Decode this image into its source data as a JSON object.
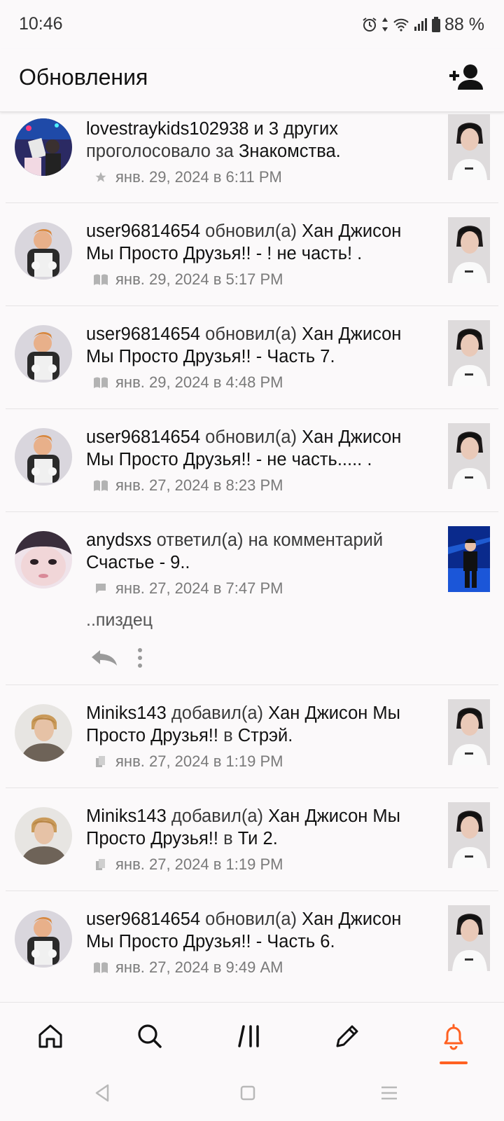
{
  "status": {
    "time": "10:46",
    "battery": "88 %"
  },
  "header": {
    "title": "Обновления"
  },
  "feed": [
    {
      "actor": "lovestraykids102938 и 3 других",
      "verb": "проголосовало за",
      "target": "Знакомства",
      "suffix": ".",
      "date": "янв. 29, 2024 в 6:11 PM",
      "meta_icon": "star-icon"
    },
    {
      "actor": "user96814654",
      "verb": "обновил(а)",
      "target": "Хан Джисон Мы Просто Друзья!! - ! не часть!",
      "suffix": " .",
      "date": "янв. 29, 2024 в 5:17 PM",
      "meta_icon": "book-icon"
    },
    {
      "actor": "user96814654",
      "verb": "обновил(а)",
      "target": "Хан Джисон Мы Просто Друзья!! - Часть 7",
      "suffix": ".",
      "date": "янв. 29, 2024 в 4:48 PM",
      "meta_icon": "book-icon"
    },
    {
      "actor": "user96814654",
      "verb": "обновил(а)",
      "target": "Хан Джисон Мы Просто Друзья!! - не часть.....",
      "suffix": " .",
      "date": "янв. 27, 2024 в 8:23 PM",
      "meta_icon": "book-icon"
    },
    {
      "actor": "anydsxs",
      "verb": "ответил(а) на комментарий",
      "target": "Счастье - 9.",
      "suffix": ".",
      "date": "янв. 27, 2024 в 7:47 PM",
      "meta_icon": "comment-icon",
      "excerpt": "..пиздец"
    },
    {
      "actor": "Miniks143",
      "verb": "добавил(а)",
      "target": "Хан Джисон Мы Просто Друзья!!",
      "mid": "в",
      "target2": "Стрэй",
      "suffix": ".",
      "date": "янв. 27, 2024 в 1:19 PM",
      "meta_icon": "list-icon"
    },
    {
      "actor": "Miniks143",
      "verb": "добавил(а)",
      "target": "Хан Джисон Мы Просто Друзья!!",
      "mid": "в",
      "target2": "Ти 2",
      "suffix": ".",
      "date": "янв. 27, 2024 в 1:19 PM",
      "meta_icon": "list-icon"
    },
    {
      "actor": "user96814654",
      "verb": "обновил(а)",
      "target": "Хан Джисон Мы Просто Друзья!! - Часть 6",
      "suffix": ".",
      "date": "янв. 27, 2024 в 9:49 AM",
      "meta_icon": "book-icon"
    }
  ],
  "nav": [
    {
      "name": "home-icon",
      "active": false
    },
    {
      "name": "search-icon",
      "active": false
    },
    {
      "name": "library-icon",
      "active": false
    },
    {
      "name": "write-icon",
      "active": false
    },
    {
      "name": "notifications-icon",
      "active": true
    }
  ],
  "colors": {
    "accent": "#ff6122",
    "text": "#121212",
    "meta": "#7a7a7a"
  }
}
